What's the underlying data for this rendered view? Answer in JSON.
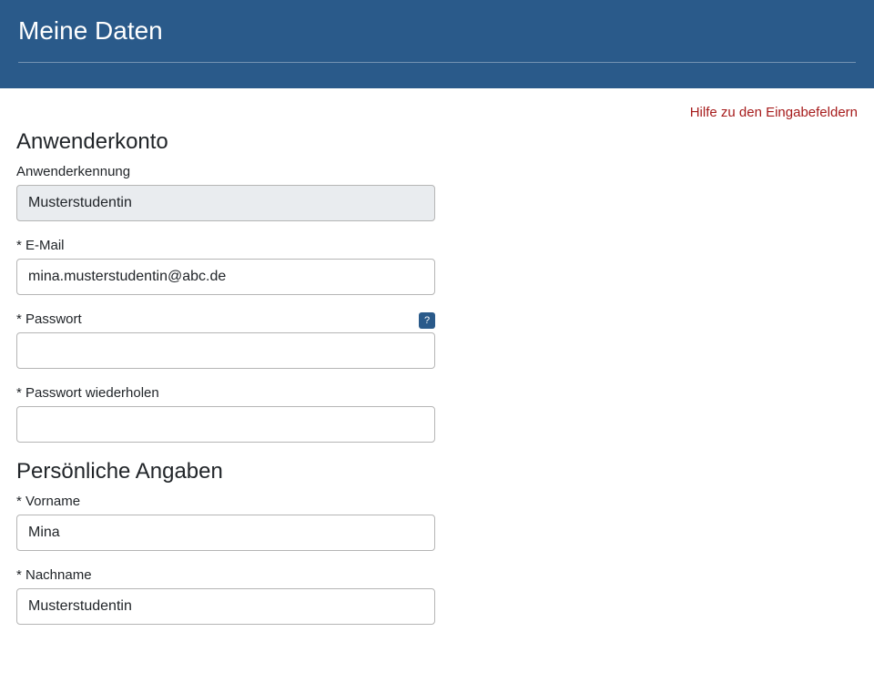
{
  "header": {
    "title": "Meine Daten"
  },
  "help_link": "Hilfe zu den Eingabefeldern",
  "sections": {
    "account": {
      "title": "Anwenderkonto",
      "username_label": "Anwenderkennung",
      "username_value": "Musterstudentin",
      "email_label": "* E-Mail",
      "email_value": "mina.musterstudentin@abc.de",
      "password_label": "* Passwort",
      "password_value": "",
      "password_repeat_label": "* Passwort wiederholen",
      "password_repeat_value": "",
      "help_icon": "?"
    },
    "personal": {
      "title": "Persönliche Angaben",
      "firstname_label": "* Vorname",
      "firstname_value": "Mina",
      "lastname_label": "* Nachname",
      "lastname_value": "Musterstudentin"
    }
  }
}
